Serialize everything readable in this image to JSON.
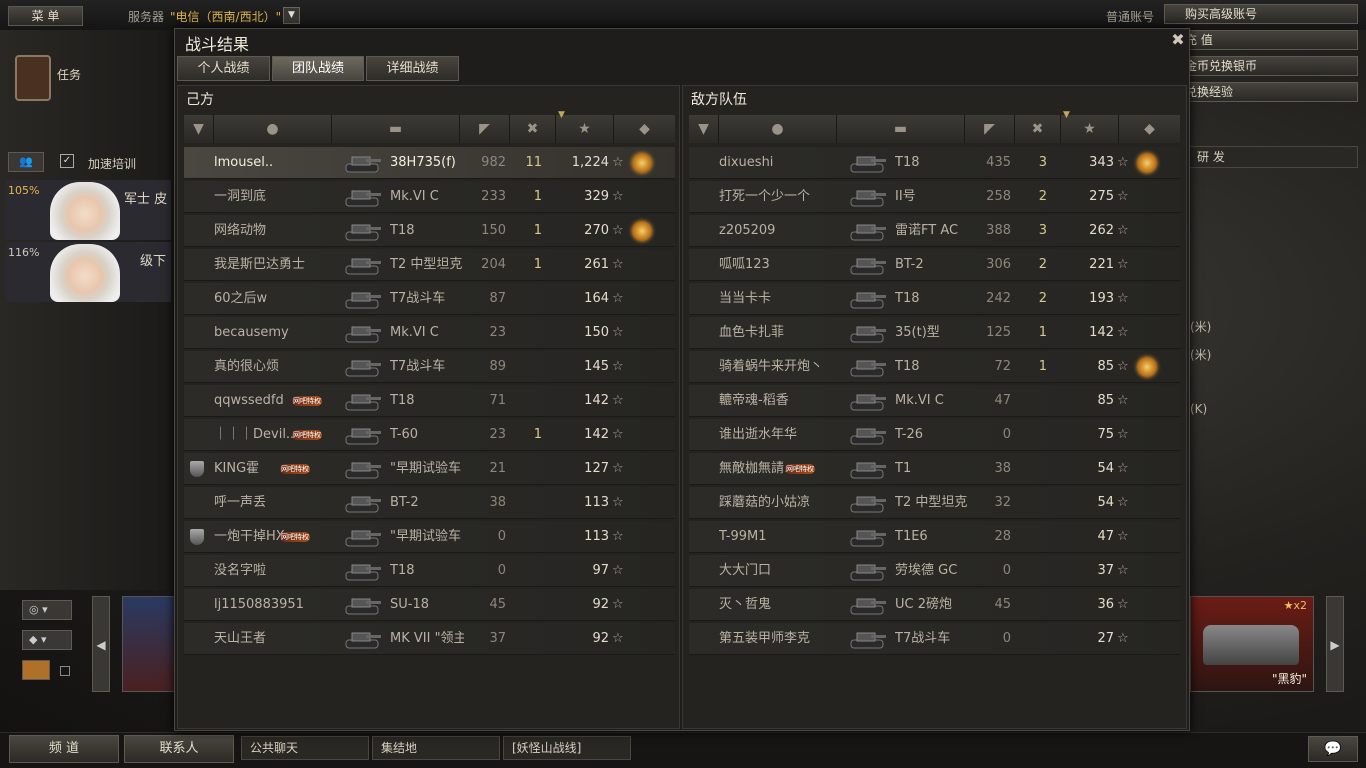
{
  "topbar": {
    "menu_label": "菜 单",
    "server_label": "服务器",
    "server_value": "\"电信（西南/西北）\"",
    "account_label": "普通账号"
  },
  "right_buttons": [
    "购买高级账号",
    "充 值",
    "金币兑换银币",
    "兑换经验"
  ],
  "right_bg_buttons": [
    "研 发"
  ],
  "left": {
    "task_label": "任务",
    "crew_label": "加速培训",
    "crew_pct_1": "105%",
    "crew_pct_2": "116%",
    "crew_text_1": "军士 皮",
    "crew_text_2": "级下"
  },
  "dialog": {
    "title": "战斗结果",
    "tabs": [
      {
        "label": "个人战绩"
      },
      {
        "label": "团队战绩"
      },
      {
        "label": "详细战绩"
      }
    ],
    "ally": {
      "title": "己方"
    },
    "enemy": {
      "title": "敌方队伍"
    },
    "star_glyph": "☆",
    "vip_text": "网吧特权"
  },
  "ally_rows": [
    {
      "name": "lmousel..",
      "tank": "38H735(f)",
      "dmg": "982",
      "kills": "11",
      "xp": "1,224",
      "medal": true,
      "me": true
    },
    {
      "name": "一洞到底",
      "tank": "Mk.VI C",
      "dmg": "233",
      "kills": "1",
      "xp": "329"
    },
    {
      "name": "网络动物",
      "tank": "T18",
      "dmg": "150",
      "kills": "1",
      "xp": "270",
      "medal": true
    },
    {
      "name": "我是斯巴达勇士",
      "tank": "T2 中型坦克",
      "dmg": "204",
      "kills": "1",
      "xp": "261"
    },
    {
      "name": "60之后w",
      "tank": "T7战斗车",
      "dmg": "87",
      "kills": "",
      "xp": "164"
    },
    {
      "name": "becausemy",
      "tank": "Mk.VI C",
      "dmg": "23",
      "kills": "",
      "xp": "150"
    },
    {
      "name": "真的很心烦",
      "tank": "T7战斗车",
      "dmg": "89",
      "kills": "",
      "xp": "145"
    },
    {
      "name": "qqwssedfd",
      "tank": "T18",
      "dmg": "71",
      "kills": "",
      "xp": "142",
      "vip": true
    },
    {
      "name": "｜｜｜Devil..",
      "tank": "T-60",
      "dmg": "23",
      "kills": "1",
      "xp": "142",
      "vip": true
    },
    {
      "name": "KING霍",
      "tank": "\"早期试验车",
      "dmg": "21",
      "kills": "",
      "xp": "127",
      "vip": true,
      "badge": true
    },
    {
      "name": "呼一声丢",
      "tank": "BT-2",
      "dmg": "38",
      "kills": "",
      "xp": "113"
    },
    {
      "name": "一炮干掉HX..",
      "tank": "\"早期试验车",
      "dmg": "0",
      "kills": "",
      "xp": "113",
      "vip": true,
      "badge": true
    },
    {
      "name": "没名字啦",
      "tank": "T18",
      "dmg": "0",
      "kills": "",
      "xp": "97"
    },
    {
      "name": "lj1150883951",
      "tank": "SU-18",
      "dmg": "45",
      "kills": "",
      "xp": "92"
    },
    {
      "name": "天山王者",
      "tank": "MK VII \"领主",
      "dmg": "37",
      "kills": "",
      "xp": "92"
    }
  ],
  "enemy_rows": [
    {
      "name": "dixueshi",
      "tank": "T18",
      "dmg": "435",
      "kills": "3",
      "xp": "343",
      "medal": true
    },
    {
      "name": "打死一个少一个",
      "tank": "II号",
      "dmg": "258",
      "kills": "2",
      "xp": "275"
    },
    {
      "name": "z205209",
      "tank": "雷诺FT AC",
      "dmg": "388",
      "kills": "3",
      "xp": "262"
    },
    {
      "name": "呱呱123",
      "tank": "BT-2",
      "dmg": "306",
      "kills": "2",
      "xp": "221"
    },
    {
      "name": "当当卡卡",
      "tank": "T18",
      "dmg": "242",
      "kills": "2",
      "xp": "193"
    },
    {
      "name": "血色卡扎菲",
      "tank": "35(t)型",
      "dmg": "125",
      "kills": "1",
      "xp": "142"
    },
    {
      "name": "骑着蜗牛来开炮丶",
      "tank": "T18",
      "dmg": "72",
      "kills": "1",
      "xp": "85",
      "medal": true
    },
    {
      "name": "轆帝魂-稻香",
      "tank": "Mk.VI C",
      "dmg": "47",
      "kills": "",
      "xp": "85"
    },
    {
      "name": "谁出逝水年华",
      "tank": "T-26",
      "dmg": "0",
      "kills": "",
      "xp": "75"
    },
    {
      "name": "無敵枷無請..",
      "tank": "T1",
      "dmg": "38",
      "kills": "",
      "xp": "54",
      "vip": true
    },
    {
      "name": "踩蘑菇的小姑凉",
      "tank": "T2 中型坦克",
      "dmg": "32",
      "kills": "",
      "xp": "54"
    },
    {
      "name": "T-99M1",
      "tank": "T1E6",
      "dmg": "28",
      "kills": "",
      "xp": "47"
    },
    {
      "name": "大大门口",
      "tank": "劳埃德 GC",
      "dmg": "0",
      "kills": "",
      "xp": "37"
    },
    {
      "name": "灭丶哲鬼",
      "tank": "UC 2磅炮",
      "dmg": "45",
      "kills": "",
      "xp": "36"
    },
    {
      "name": "第五装甲师李克",
      "tank": "T7战斗车",
      "dmg": "0",
      "kills": "",
      "xp": "27"
    }
  ],
  "bottom": {
    "channel": "频 道",
    "contacts": "联系人",
    "chat_tabs": [
      "公共聊天",
      "集结地",
      "[妖怪山战线]"
    ]
  },
  "carousel": {
    "right_tank_name": "\"黑豹\"",
    "right_multiplier": "x2"
  },
  "side_texts": [
    "(米)",
    "(米)",
    "(K)"
  ]
}
